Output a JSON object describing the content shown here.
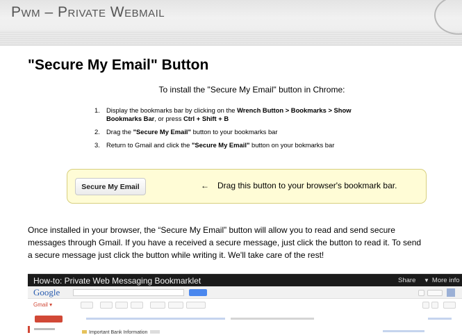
{
  "header": {
    "brand": "Pwm – Private Webmail"
  },
  "page": {
    "title": "\"Secure My Email\" Button",
    "intro": "To install the \"Secure My Email\" button in Chrome:",
    "steps": [
      {
        "num": "1.",
        "text_a": "Display the bookmarks bar by clicking on the ",
        "bold_a": "Wrench Button > Bookmarks > Show Bookmarks Bar",
        "text_b": ", or press ",
        "bold_b": "Ctrl + Shift + B"
      },
      {
        "num": "2.",
        "text_a": "Drag the ",
        "bold_a": "\"Secure My Email\"",
        "text_b": " button to your bookmarks bar"
      },
      {
        "num": "3.",
        "text_a": "Return to Gmail and click the ",
        "bold_a": "\"Secure My Email\"",
        "text_b": " button on your bokmarks bar"
      }
    ],
    "drag_box": {
      "button_label": "Secure My Email",
      "arrow": "←",
      "hint": "Drag this button to your browser's bookmark bar."
    },
    "description": [
      "Once installed in your browser, the “Secure My Email” button will allow you to read and send secure",
      "messages through Gmail. If you have a received a secure message, just click the button to read it. To send",
      "a secure message just click the button while writing it. We'll take care of the rest!"
    ]
  },
  "video": {
    "title": "How-to: Private Web Messaging Bookmarklet",
    "share": "Share",
    "more_info": "More info",
    "gmail_logo": "Google",
    "gmail_label": "Gmail",
    "email_subject": "Important Bank Information"
  }
}
